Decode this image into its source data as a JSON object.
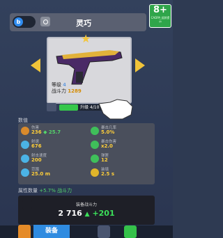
{
  "age_badge": {
    "rating": "8+",
    "note": "CADPA 适龄提示"
  },
  "top_bar": {
    "toggle_label": "b",
    "title": "灵巧"
  },
  "weapon": {
    "level_label": "等级",
    "level": "4",
    "power_label": "战斗力",
    "power": "1289",
    "name_icon": "pistol-icon"
  },
  "upgrade": {
    "label": "升级",
    "progress_text": "4/10",
    "progress": 0.4
  },
  "stats_section_label": "数值",
  "stats": [
    {
      "name": "伤害",
      "value": "236",
      "extra": "◆ 25.7",
      "icon": "damage-icon",
      "color": "#d98a2b"
    },
    {
      "name": "暴击几率",
      "value": "5.0%",
      "extra": "",
      "icon": "crit-icon",
      "color": "#3fbf5a"
    },
    {
      "name": "射速",
      "value": "676",
      "extra": "",
      "icon": "firerate-icon",
      "color": "#4bb3e6"
    },
    {
      "name": "暴击伤害",
      "value": "x2.0",
      "extra": "",
      "icon": "critdmg-icon",
      "color": "#3fbf5a"
    },
    {
      "name": "射击速度",
      "value": "200",
      "extra": "",
      "icon": "speed-icon",
      "color": "#4bb3e6"
    },
    {
      "name": "弹匣",
      "value": "12",
      "extra": "",
      "icon": "ammo-icon",
      "color": "#3fbf5a"
    },
    {
      "name": "范围",
      "value": "25.0 m",
      "extra": "",
      "icon": "range-icon",
      "color": "#4bb3e6"
    },
    {
      "name": "装填",
      "value": "2.5 s",
      "extra": "",
      "icon": "reload-icon",
      "color": "#e0b52a"
    }
  ],
  "attribute_label": "属性数量",
  "attribute_bonus": "+5.7% 战斗力",
  "equip": {
    "title": "装备战斗力",
    "power": "2 716",
    "delta": "+201"
  },
  "bottom": {
    "tab_label": "装备"
  },
  "colors": {
    "accent": "#f0c43a",
    "progress": "#36c74b",
    "tab": "#2f8be0"
  }
}
